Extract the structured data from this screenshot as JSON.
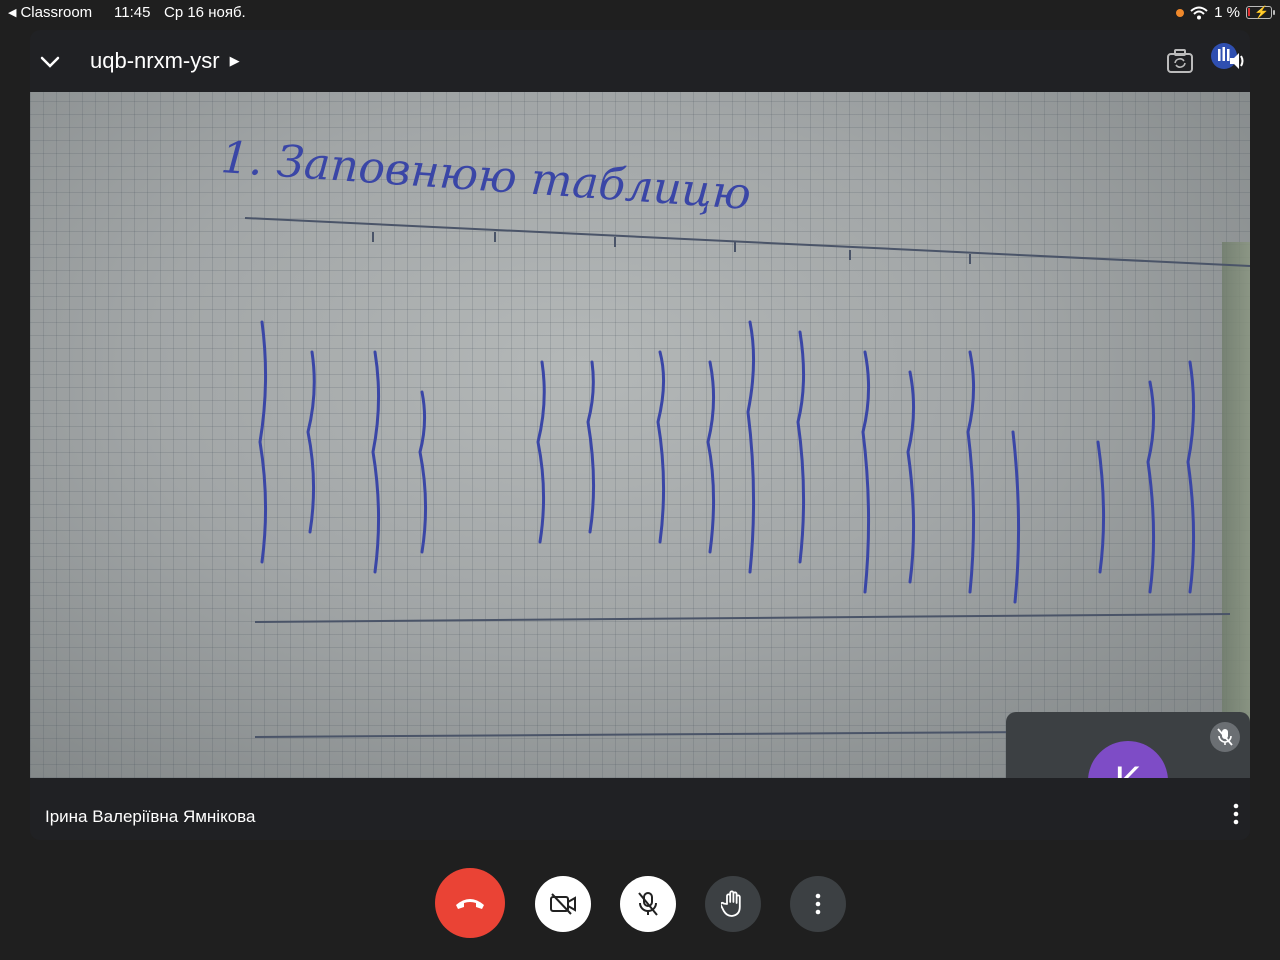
{
  "status_bar": {
    "back_app": "Classroom",
    "time": "11:45",
    "date": "Ср 16 нояб.",
    "battery": "1 %",
    "battery_level": 0.01
  },
  "meeting": {
    "code": "uqb-nrxm-ysr",
    "presenter_name": "Ірина Валеріївна Ямнікова"
  },
  "self_tile": {
    "avatar_letter": "K",
    "avatar_color": "#7e4cc6"
  },
  "handwriting": {
    "heading": "1. Заповнюю таблицю"
  },
  "colors": {
    "end_call": "#ea4335",
    "background": "#1f1f1f",
    "panel": "#202124"
  },
  "icons": [
    "chevron-down-icon",
    "camera-switch-icon",
    "audio-level-icon",
    "mic-off-icon",
    "more-vert-icon",
    "exit-fullscreen-icon",
    "hangup-icon",
    "camera-off-icon",
    "raise-hand-icon"
  ]
}
